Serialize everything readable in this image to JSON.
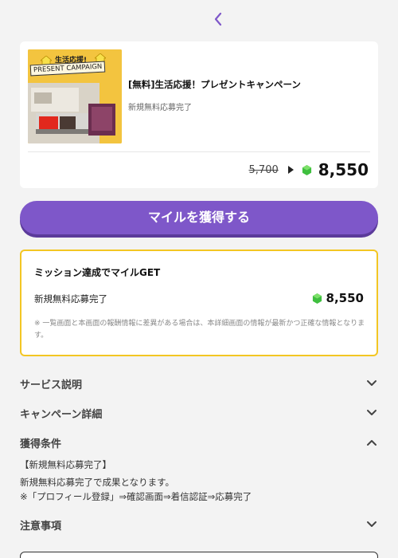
{
  "nav": {
    "back_icon": "chevron-left-icon"
  },
  "campaign": {
    "image_badge": "生活応援!",
    "image_text": "PRESENT CAMPAIGN",
    "title": "[無料]生活応援！プレゼントキャンペーン",
    "subtitle": "新規無料応募完了",
    "old_points": "5,700",
    "new_points": "8,550"
  },
  "cta": {
    "label": "マイルを獲得する"
  },
  "mission": {
    "title": "ミッション達成でマイルGET",
    "item_label": "新規無料応募完了",
    "item_points": "8,550",
    "note": "※ 一覧画面と本画面の報酬情報に差異がある場合は、本詳細画面の情報が最新かつ正確な情報となります。"
  },
  "sections": {
    "service": "サービス説明",
    "campaign_detail": "キャンペーン詳細",
    "conditions": "獲得条件",
    "notes": "注意事項"
  },
  "conditions": {
    "heading": "【新規無料応募完了】",
    "line1": "新規無料応募完了で成果となります。",
    "line2": "※「プロフィール登録」⇒確認画面⇒着信認証⇒応募完了"
  },
  "colors": {
    "accent": "#7e57c9",
    "mission_border": "#f3c623",
    "gem": "#3fbf3f"
  }
}
